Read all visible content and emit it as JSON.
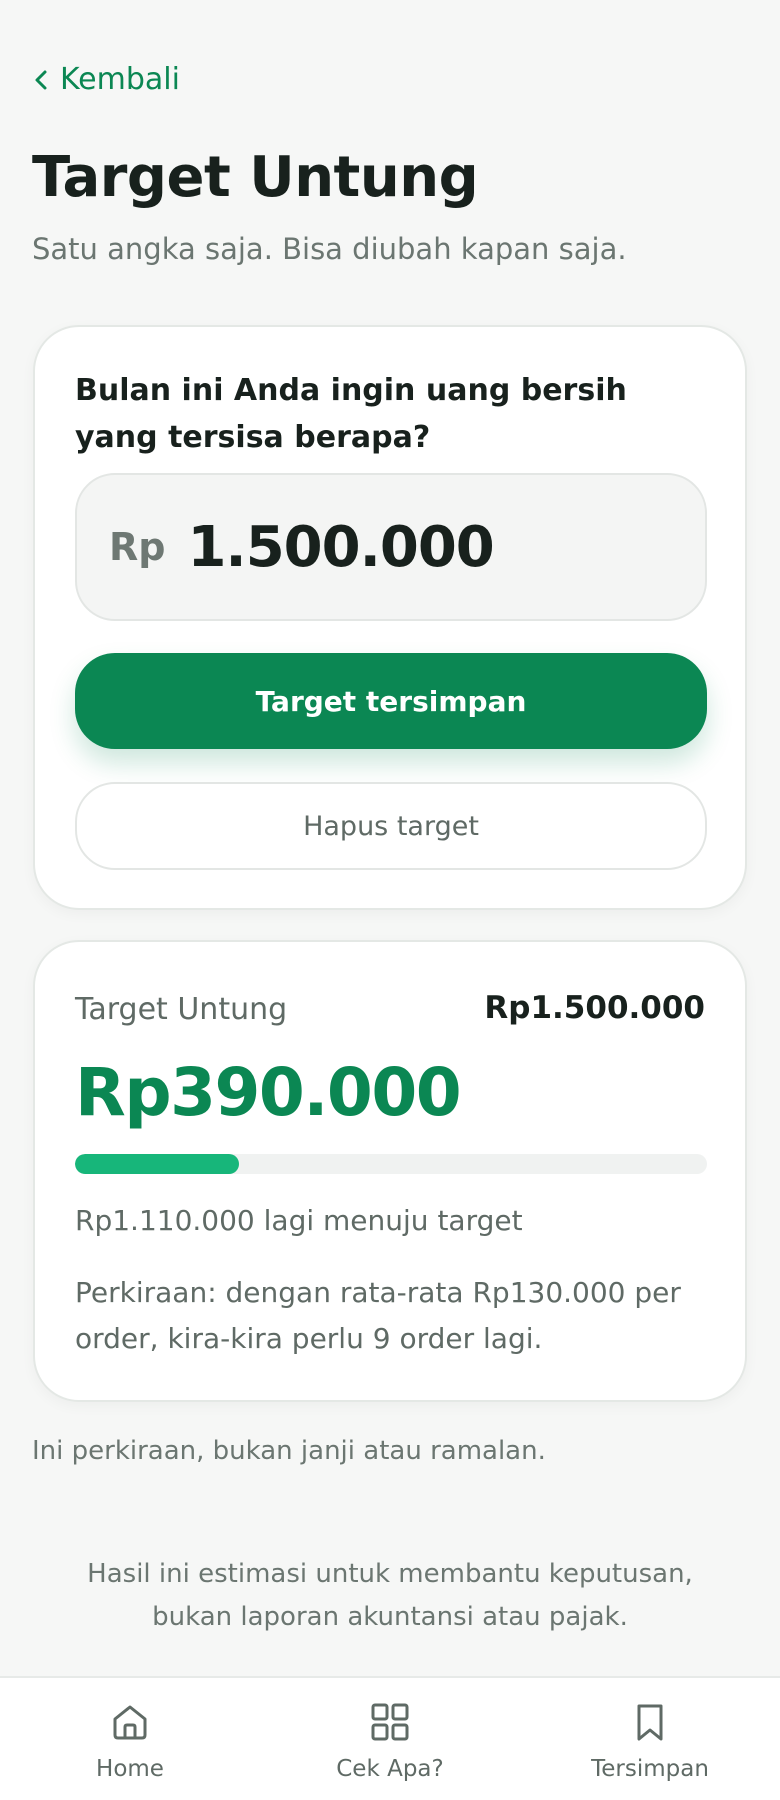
{
  "nav": {
    "back_label": "Kembali"
  },
  "header": {
    "title": "Target Untung",
    "subtitle": "Satu angka saja. Bisa diubah kapan saja."
  },
  "target_form": {
    "question": "Bulan ini Anda ingin uang bersih yang tersisa berapa?",
    "currency_prefix": "Rp",
    "amount_value": "1.500.000",
    "save_label": "Target tersimpan",
    "delete_label": "Hapus target"
  },
  "progress": {
    "label": "Target Untung",
    "target_amount": "Rp1.500.000",
    "current_amount": "Rp390.000",
    "fraction": 0.26,
    "remaining_text": "Rp1.110.000 lagi menuju target",
    "estimate_text": "Perkiraan: dengan rata-rata Rp130.000 per order, kira-kira perlu 9 order lagi."
  },
  "disclaimer": "Ini perkiraan, bukan janji atau ramalan.",
  "footnote": "Hasil ini estimasi untuk membantu keputusan, bukan laporan akuntansi atau pajak.",
  "bottom_nav": {
    "items": [
      {
        "label": "Home",
        "icon": "home-icon"
      },
      {
        "label": "Cek Apa?",
        "icon": "grid-icon"
      },
      {
        "label": "Tersimpan",
        "icon": "bookmark-icon"
      }
    ]
  },
  "colors": {
    "accent": "#0b8753",
    "progress_fill": "#17b67a",
    "background": "#f6f7f6"
  }
}
